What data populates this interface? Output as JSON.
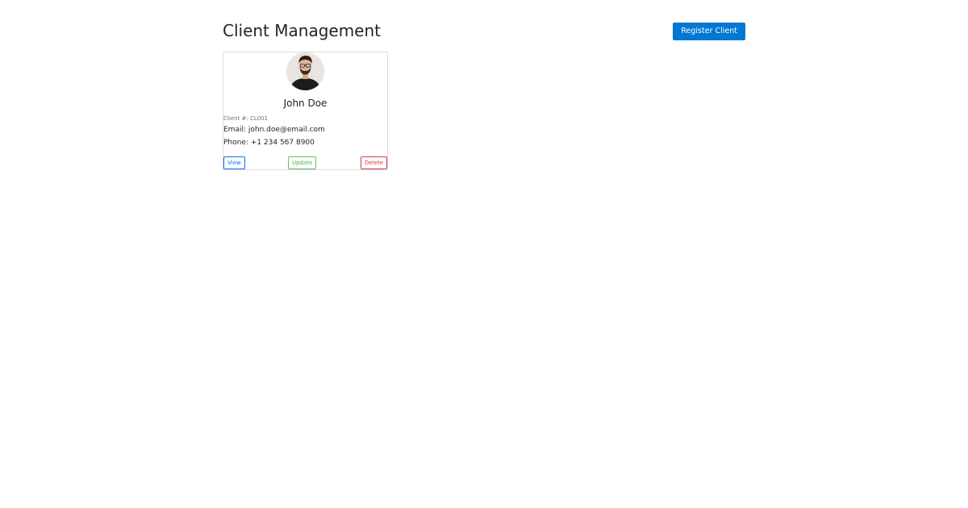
{
  "header": {
    "title": "Client Management",
    "register_label": "Register Client"
  },
  "clients": [
    {
      "name": "John Doe",
      "client_number": "Client #: CL001",
      "email": "Email: john.doe@email.com",
      "phone": "Phone: +1 234 567 8900",
      "actions": {
        "view_label": "View",
        "update_label": "Update",
        "delete_label": "Delete"
      }
    }
  ],
  "colors": {
    "primary": "#0078d4",
    "view": "#0d6efd",
    "update": "#4caf50",
    "delete": "#dc3545"
  },
  "icons": {
    "avatar": "person-photo-avatar"
  }
}
